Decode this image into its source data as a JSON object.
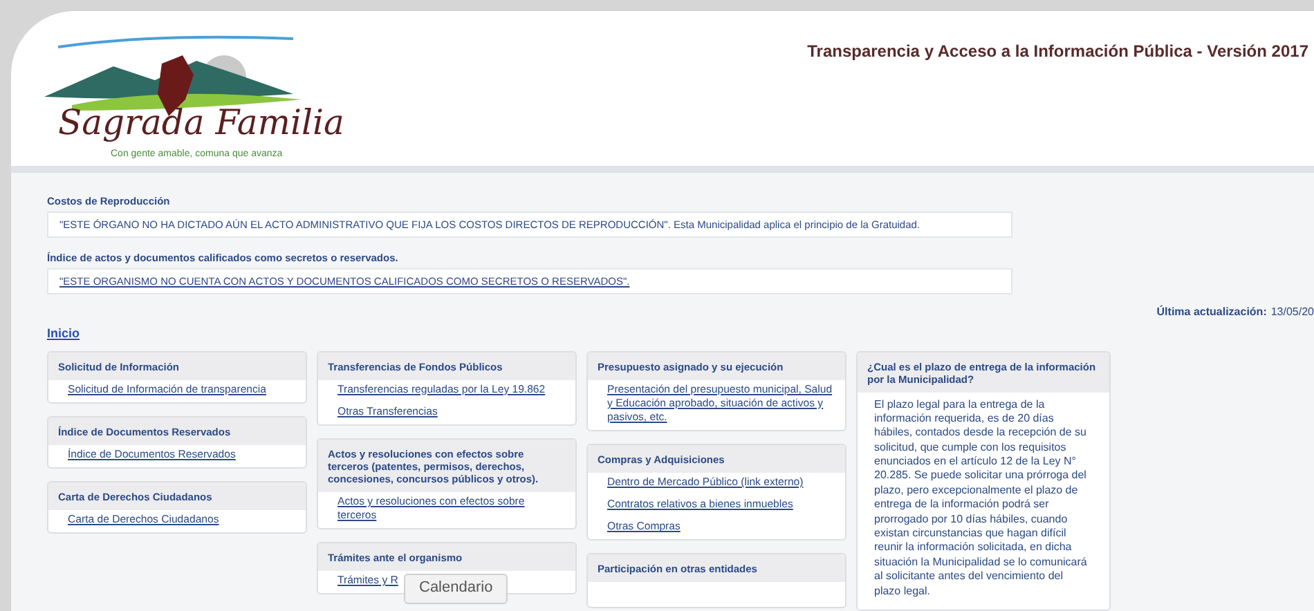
{
  "header": {
    "logo": {
      "name": "Sagrada Familia",
      "tagline": "Con gente amable, comuna que avanza"
    },
    "title": "Transparencia y Acceso a la Información Pública - Versión 2017"
  },
  "notices": [
    {
      "title": "Costos de Reproducción",
      "kind": "text",
      "text": "\"ESTE ÓRGANO NO HA DICTADO AÚN EL ACTO ADMINISTRATIVO QUE FIJA LOS COSTOS DIRECTOS DE REPRODUCCIÓN\". Esta Municipalidad aplica el principio de la Gratuidad."
    },
    {
      "title": "Índice de actos y documentos calificados como secretos o reservados.",
      "kind": "link",
      "text": "\"ESTE ORGANISMO NO CUENTA CON ACTOS Y DOCUMENTOS CALIFICADOS COMO SECRETOS O RESERVADOS\"."
    }
  ],
  "last_update": {
    "label": "Última actualización:",
    "value": "13/05/20"
  },
  "home_link": "Inicio",
  "columns": [
    [
      {
        "title": "Solicitud de Información",
        "kind": "links",
        "links": [
          "Solicitud de Información de transparencia"
        ]
      },
      {
        "title": "Índice de Documentos Reservados",
        "kind": "links",
        "links": [
          "Índice de Documentos Reservados"
        ]
      },
      {
        "title": "Carta de Derechos Ciudadanos",
        "kind": "links",
        "links": [
          "Carta de Derechos Ciudadanos"
        ]
      }
    ],
    [
      {
        "title": "Transferencias de Fondos Públicos",
        "kind": "links",
        "links": [
          "Transferencias reguladas por la Ley 19.862",
          "Otras Transferencias"
        ]
      },
      {
        "title": "Actos y resoluciones con efectos sobre terceros (patentes, permisos, derechos, concesiones, concursos públicos y otros).",
        "kind": "links",
        "links": [
          "Actos y resoluciones con efectos sobre terceros"
        ]
      },
      {
        "title": "Trámites ante el organismo",
        "kind": "links",
        "links": [
          "Trámites y R"
        ]
      }
    ],
    [
      {
        "title": "Presupuesto asignado y su ejecución",
        "kind": "links",
        "links": [
          "Presentación del presupuesto municipal, Salud y Educación aprobado, situación de activos y pasivos, etc."
        ]
      },
      {
        "title": "Compras y Adquisiciones",
        "kind": "links",
        "links": [
          "Dentro de Mercado Público (link externo)",
          "Contratos relativos a bienes inmuebles",
          "Otras Compras"
        ]
      },
      {
        "title": "Participación en otras entidades",
        "kind": "links"
      }
    ],
    [
      {
        "title": "¿Cual es el plazo de entrega de la información por la Municipalidad?",
        "kind": "text",
        "text": "El plazo legal para la entrega de la información requerida, es de 20 días hábiles, contados desde la recepción de su solicitud, que cumple con los requisitos enunciados en el artículo 12 de la Ley N° 20.285. Se puede solicitar una prórroga del plazo, pero excepcionalmente el plazo de entrega de la información podrá ser prorrogado por 10 días hábiles, cuando existan circunstancias que hagan difícil reunir la información solicitada, en dicha situación la Municipalidad se lo comunicará al solicitante antes del vencimiento del plazo legal."
      }
    ]
  ],
  "tooltip": "Calendario"
}
